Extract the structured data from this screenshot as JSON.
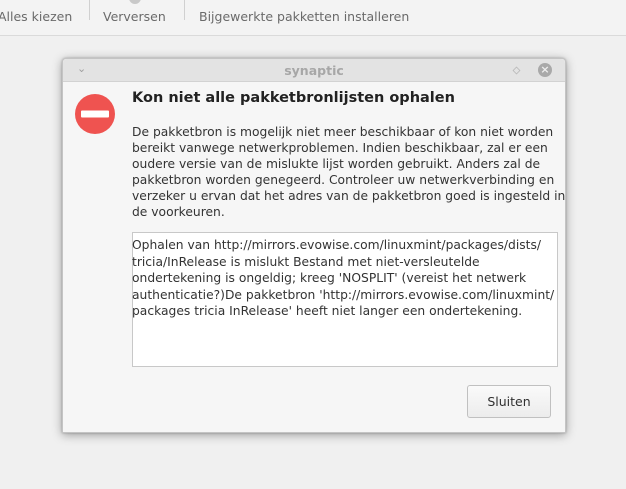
{
  "toolbar": {
    "select_all": "Alles kiezen",
    "refresh": "Verversen",
    "install_updates": "Bijgewerkte pakketten installeren"
  },
  "dialog": {
    "window_title": "synaptic",
    "heading": "Kon niet alle pakketbronlijsten ophalen",
    "message_lines": [
      "De pakketbron is mogelijk niet meer beschikbaar of kon niet worden",
      "bereikt vanwege netwerkproblemen. Indien beschikbaar, zal er een",
      "oudere versie van de mislukte lijst worden gebruikt. Anders zal de",
      "pakketbron worden genegeerd. Controleer uw netwerkverbinding en",
      "verzeker u ervan dat het adres van de pakketbron goed is ingesteld in",
      "de voorkeuren."
    ],
    "details_lines": [
      "Ophalen van http://mirrors.evowise.com/linuxmint/packages/dists/",
      "tricia/InRelease is mislukt  Bestand met niet-versleutelde",
      "ondertekening is ongeldig; kreeg 'NOSPLIT' (vereist het netwerk",
      "authenticatie?)De pakketbron 'http://mirrors.evowise.com/linuxmint/",
      "packages tricia InRelease' heeft niet langer een ondertekening."
    ],
    "close_label": "Sluiten"
  },
  "icons": {
    "error": "error-icon",
    "window_menu": "chevron-down-icon",
    "restore": "restore-icon",
    "close": "close-icon"
  },
  "colors": {
    "error_red": "#ef5350",
    "dialog_bg": "#f6f6f6",
    "titlebar_bg": "#e3e3e3"
  }
}
